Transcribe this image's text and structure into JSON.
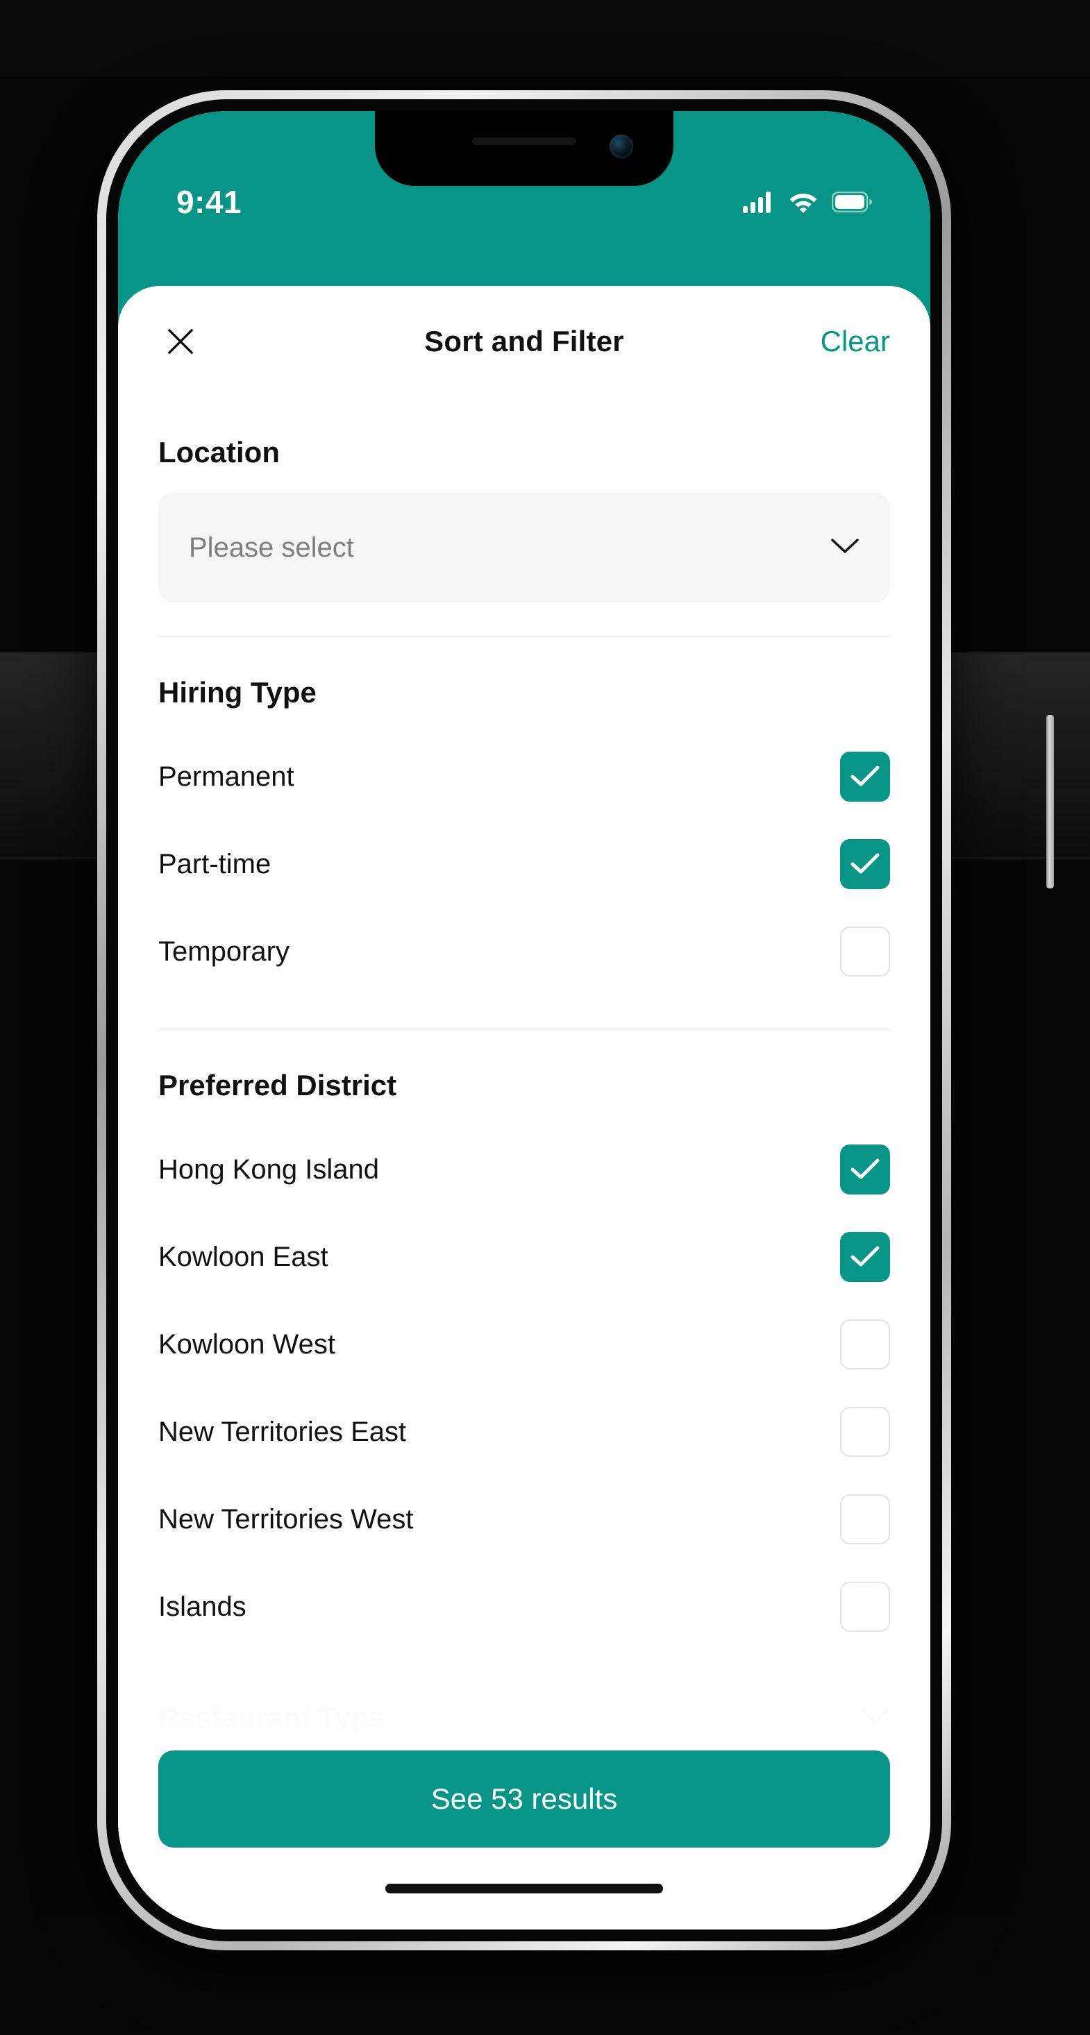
{
  "status_bar": {
    "time": "9:41",
    "icons": [
      "cellular-signal-icon",
      "wifi-icon",
      "battery-icon"
    ]
  },
  "header": {
    "close_icon": "close-icon",
    "title": "Sort and Filter",
    "clear_label": "Clear"
  },
  "location": {
    "title": "Location",
    "placeholder": "Please select",
    "chevron_icon": "chevron-down-icon"
  },
  "hiring_type": {
    "title": "Hiring Type",
    "options": [
      {
        "label": "Permanent",
        "checked": true
      },
      {
        "label": "Part-time",
        "checked": true
      },
      {
        "label": "Temporary",
        "checked": false
      }
    ]
  },
  "preferred_district": {
    "title": "Preferred District",
    "options": [
      {
        "label": "Hong Kong Island",
        "checked": true
      },
      {
        "label": "Kowloon East",
        "checked": true
      },
      {
        "label": "Kowloon West",
        "checked": false
      },
      {
        "label": "New Territories East",
        "checked": false
      },
      {
        "label": "New Territories West",
        "checked": false
      },
      {
        "label": "Islands",
        "checked": false
      }
    ]
  },
  "restaurant_type": {
    "title": "Restaurant Type",
    "chevron_icon": "chevron-down-icon"
  },
  "footer": {
    "cta_label": "See 53 results"
  },
  "colors": {
    "accent": "#089587",
    "text": "#111111",
    "placeholder": "#7e7e7e",
    "field_bg": "#f5f5f5",
    "divider": "#ededed",
    "muted": "#b9b9b9"
  }
}
